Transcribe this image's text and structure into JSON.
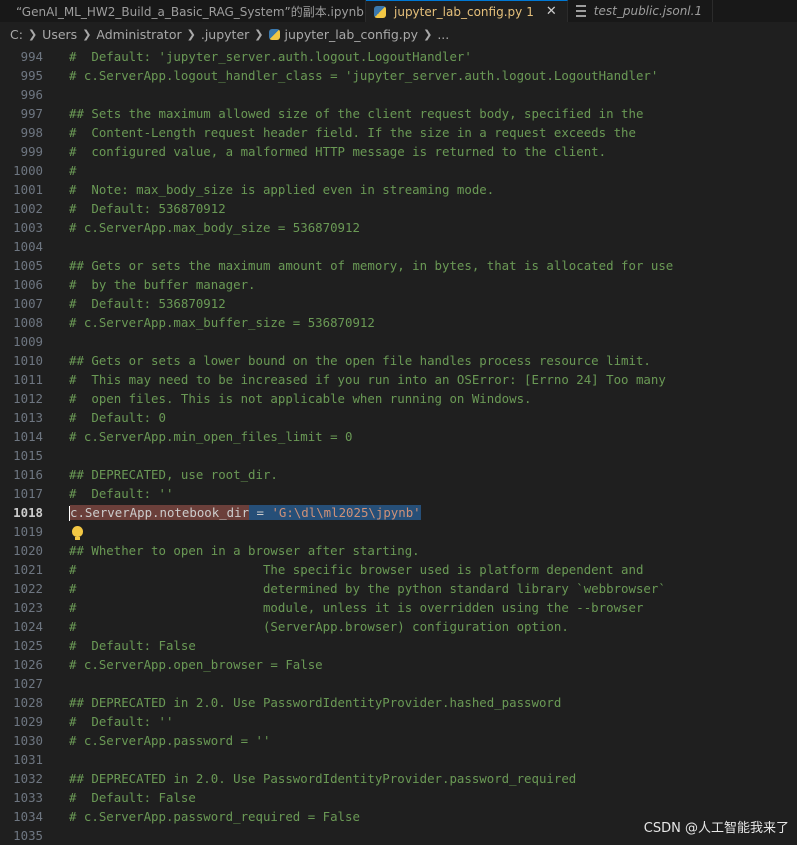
{
  "tabs": [
    {
      "label": "“GenAI_ML_HW2_Build_a_Basic_RAG_System”的副本.ipynb",
      "icon": "notebook-icon"
    },
    {
      "label": "jupyter_lab_config.py",
      "modified_count": "1",
      "icon": "python-file-icon",
      "active": true
    },
    {
      "label": "test_public.jsonl.1",
      "icon": "text-file-icon"
    }
  ],
  "breadcrumb": [
    "C:",
    "Users",
    "Administrator",
    ".jupyter",
    "jupyter_lab_config.py",
    "..."
  ],
  "lines": [
    {
      "n": "994",
      "text": "#  Default: 'jupyter_server.auth.logout.LogoutHandler'"
    },
    {
      "n": "995",
      "text": "# c.ServerApp.logout_handler_class = 'jupyter_server.auth.logout.LogoutHandler'"
    },
    {
      "n": "996",
      "text": ""
    },
    {
      "n": "997",
      "text": "## Sets the maximum allowed size of the client request body, specified in the"
    },
    {
      "n": "998",
      "text": "#  Content-Length request header field. If the size in a request exceeds the"
    },
    {
      "n": "999",
      "text": "#  configured value, a malformed HTTP message is returned to the client."
    },
    {
      "n": "1000",
      "text": "#"
    },
    {
      "n": "1001",
      "text": "#  Note: max_body_size is applied even in streaming mode."
    },
    {
      "n": "1002",
      "text": "#  Default: 536870912"
    },
    {
      "n": "1003",
      "text": "# c.ServerApp.max_body_size = 536870912"
    },
    {
      "n": "1004",
      "text": ""
    },
    {
      "n": "1005",
      "text": "## Gets or sets the maximum amount of memory, in bytes, that is allocated for use"
    },
    {
      "n": "1006",
      "text": "#  by the buffer manager."
    },
    {
      "n": "1007",
      "text": "#  Default: 536870912"
    },
    {
      "n": "1008",
      "text": "# c.ServerApp.max_buffer_size = 536870912"
    },
    {
      "n": "1009",
      "text": ""
    },
    {
      "n": "1010",
      "text": "## Gets or sets a lower bound on the open file handles process resource limit."
    },
    {
      "n": "1011",
      "text": "#  This may need to be increased if you run into an OSError: [Errno 24] Too many"
    },
    {
      "n": "1012",
      "text": "#  open files. This is not applicable when running on Windows."
    },
    {
      "n": "1013",
      "text": "#  Default: 0"
    },
    {
      "n": "1014",
      "text": "# c.ServerApp.min_open_files_limit = 0"
    },
    {
      "n": "1015",
      "text": ""
    },
    {
      "n": "1016",
      "text": "## DEPRECATED, use root_dir."
    },
    {
      "n": "1017",
      "text": "#  Default: ''"
    },
    {
      "n": "1018",
      "text": "",
      "current": true
    },
    {
      "n": "1019",
      "text": ""
    },
    {
      "n": "1020",
      "text": "## Whether to open in a browser after starting."
    },
    {
      "n": "1021",
      "text": "#                         The specific browser used is platform dependent and"
    },
    {
      "n": "1022",
      "text": "#                         determined by the python standard library `webbrowser`"
    },
    {
      "n": "1023",
      "text": "#                         module, unless it is overridden using the --browser"
    },
    {
      "n": "1024",
      "text": "#                         (ServerApp.browser) configuration option."
    },
    {
      "n": "1025",
      "text": "#  Default: False"
    },
    {
      "n": "1026",
      "text": "# c.ServerApp.open_browser = False"
    },
    {
      "n": "1027",
      "text": ""
    },
    {
      "n": "1028",
      "text": "## DEPRECATED in 2.0. Use PasswordIdentityProvider.hashed_password"
    },
    {
      "n": "1029",
      "text": "#  Default: ''"
    },
    {
      "n": "1030",
      "text": "# c.ServerApp.password = ''"
    },
    {
      "n": "1031",
      "text": ""
    },
    {
      "n": "1032",
      "text": "## DEPRECATED in 2.0. Use PasswordIdentityProvider.password_required"
    },
    {
      "n": "1033",
      "text": "#  Default: False"
    },
    {
      "n": "1034",
      "text": "# c.ServerApp.password_required = False"
    },
    {
      "n": "1035",
      "text": ""
    }
  ],
  "current_line": {
    "part1": "c.ServerApp.notebook_dir",
    "part2": " = ",
    "part3": "'G:\\dl\\ml2025\\jpynb'"
  },
  "watermark": "CSDN @人工智能我来了",
  "colors": {
    "background": "#1f1f1f",
    "comment": "#6a9955",
    "line_number": "#6e7681",
    "string": "#ce9178",
    "selection": "#264f78",
    "modified_tab": "#e5c07b",
    "accent": "#0078d4"
  }
}
